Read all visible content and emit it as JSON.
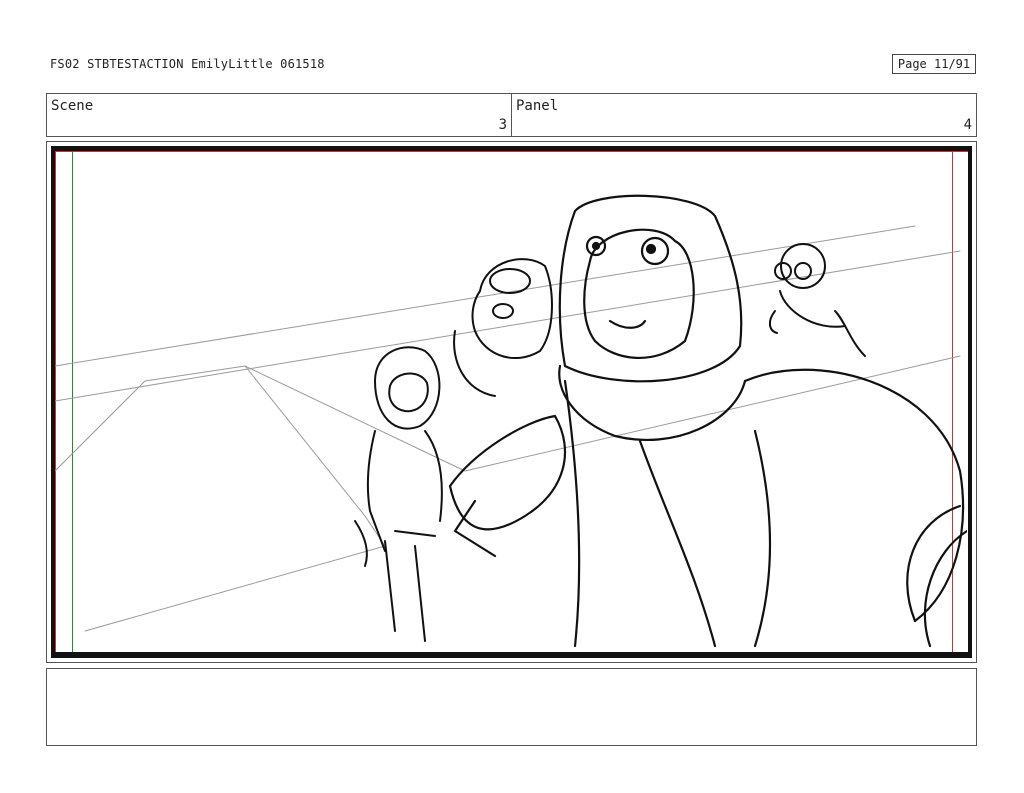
{
  "header": {
    "title": "FS02 STBTESTACTION EmilyLittle 061518",
    "page": "Page 11/91"
  },
  "meta": {
    "scene_label": "Scene",
    "scene_value": "3",
    "panel_label": "Panel",
    "panel_value": "4"
  },
  "notes": {
    "text": ""
  },
  "sketch": {
    "subject": "rough storyboard drawing of a group of astronaut characters looking up",
    "line_color": "#111111",
    "guide_color": "#999999"
  }
}
